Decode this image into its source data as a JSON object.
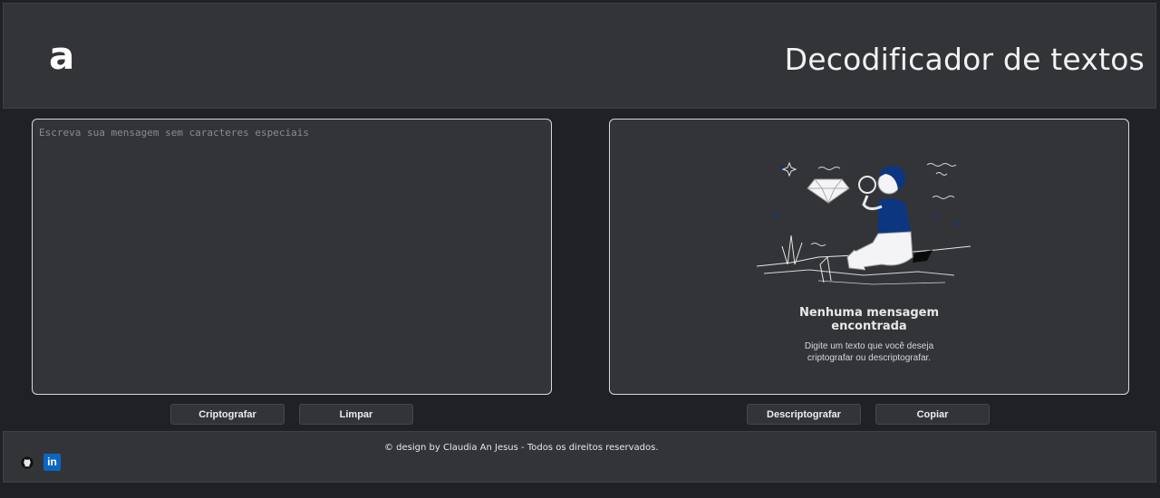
{
  "header": {
    "logo_text": "a",
    "title": "Decodificador de textos"
  },
  "input": {
    "placeholder": "Escreva sua mensagem sem caracteres especiais",
    "value": ""
  },
  "output": {
    "empty_title_line1": "Nenhuma mensagem",
    "empty_title_line2": "encontrada",
    "empty_desc_line1": "Digite um texto que você deseja",
    "empty_desc_line2": "criptografar ou descriptografar."
  },
  "actions": {
    "encrypt_label": "Criptografar",
    "clear_label": "Limpar",
    "decrypt_label": "Descriptografar",
    "copy_label": "Copiar"
  },
  "footer": {
    "credits": "© design by Claudia An Jesus - Todos os direitos reservados.",
    "github_icon": "github-icon",
    "linkedin_icon": "linkedin-icon",
    "linkedin_text": "in"
  },
  "colors": {
    "background": "#202124",
    "panel": "#333438",
    "accent_blue": "#0d3680",
    "linkedin": "#0a66c2"
  }
}
